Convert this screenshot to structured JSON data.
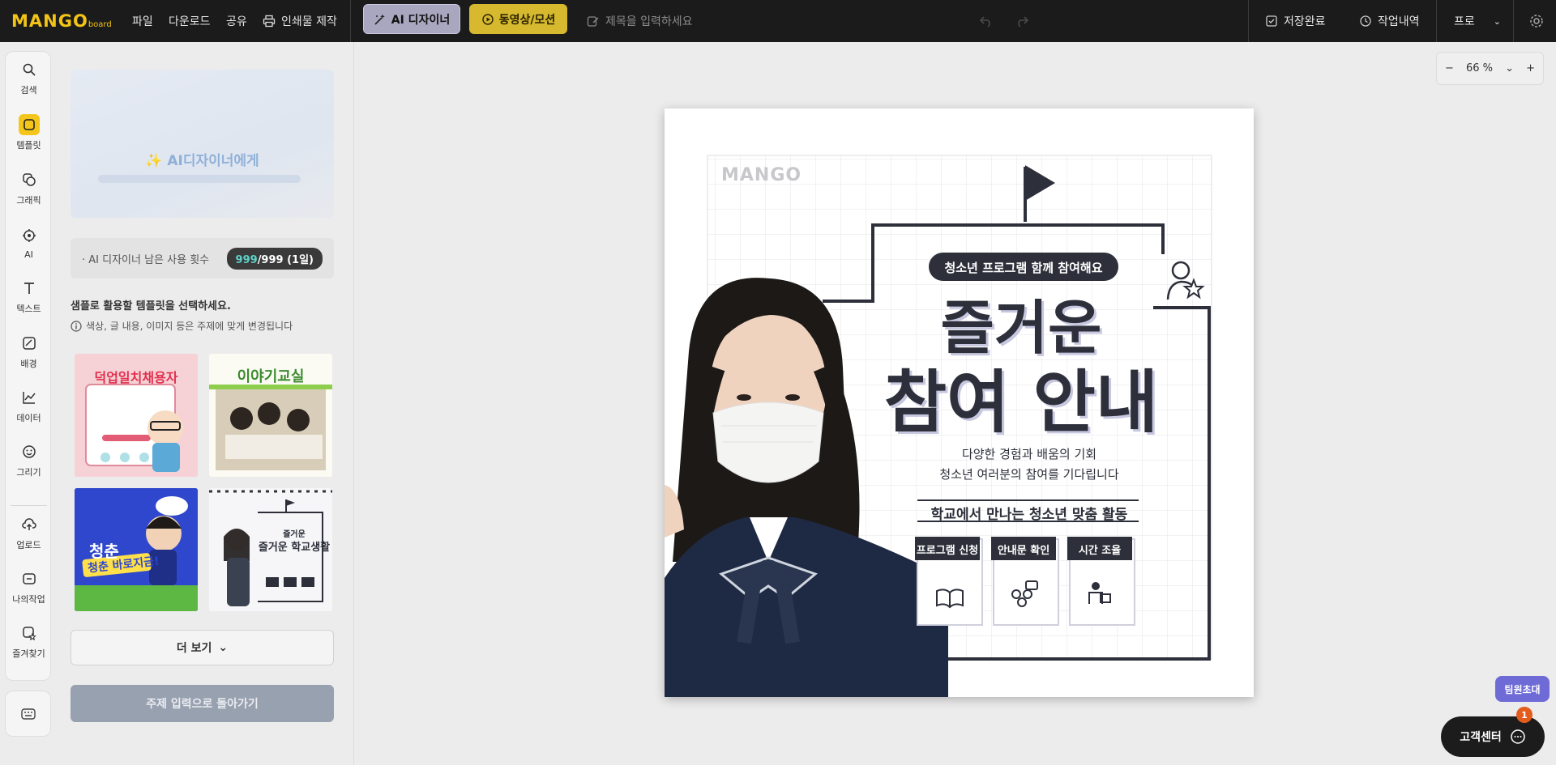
{
  "app": {
    "logo_main": "MANGO",
    "logo_sub": "board"
  },
  "topbar": {
    "menu": [
      "파일",
      "다운로드",
      "공유",
      "인쇄물 제작"
    ],
    "ai_designer_label": "AI 디자이너",
    "motion_label": "동영상/모션",
    "title_placeholder": "제목을 입력하세요",
    "save_status": "저장완료",
    "history_label": "작업내역",
    "plan_label": "프로"
  },
  "sidebar": {
    "items": [
      {
        "label": "검색",
        "icon": "search-icon"
      },
      {
        "label": "템플릿",
        "icon": "template-icon",
        "active": true
      },
      {
        "label": "그래픽",
        "icon": "graphic-icon"
      },
      {
        "label": "AI",
        "icon": "ai-icon"
      },
      {
        "label": "텍스트",
        "icon": "text-icon"
      },
      {
        "label": "배경",
        "icon": "background-icon"
      },
      {
        "label": "데이터",
        "icon": "chart-icon"
      },
      {
        "label": "그리기",
        "icon": "draw-icon"
      },
      {
        "label": "업로드",
        "icon": "upload-icon"
      },
      {
        "label": "나의작업",
        "icon": "folder-icon"
      },
      {
        "label": "즐겨찾기",
        "icon": "favorite-icon"
      }
    ]
  },
  "panel": {
    "banner_title": "AI디자이너에게",
    "quota_label": "· AI 디자이너 남은 사용 횟수",
    "quota_used": "999",
    "quota_total": "/999 (1일)",
    "guide_title": "샘플로 활용할 템플릿을 선택하세요.",
    "guide_sub": "색상, 글 내용, 이미지 등은 주제에 맞게 변경됩니다",
    "templates": [
      {
        "title": "덕업일치채용자"
      },
      {
        "title": "이야기교실"
      },
      {
        "title": "청춘 바로지금!",
        "badge": "청춘"
      },
      {
        "title": "즐거운 학교생활",
        "subtitle": "즐거운"
      }
    ],
    "more_label": "더 보기",
    "back_label": "주제 입력으로 돌아가기"
  },
  "zoom": {
    "value": "66 %"
  },
  "poster": {
    "logo": "MANGO",
    "pill": "청소년 프로그램 함께 참여해요",
    "headline1": "즐거운",
    "headline2": "참여 안내",
    "desc1": "다양한 경험과 배움의 기회",
    "desc2": "청소년 여러분의 참여를 기다립니다",
    "subhead": "학교에서 만나는 청소년 맞춤 활동",
    "cards": [
      {
        "label": "프로그램 신청",
        "icon": "book-icon"
      },
      {
        "label": "안내문 확인",
        "icon": "people-icon"
      },
      {
        "label": "시간 조율",
        "icon": "teacher-icon"
      }
    ]
  },
  "widgets": {
    "invite": "팀원초대",
    "support": "고객센터",
    "support_badge": "1"
  }
}
